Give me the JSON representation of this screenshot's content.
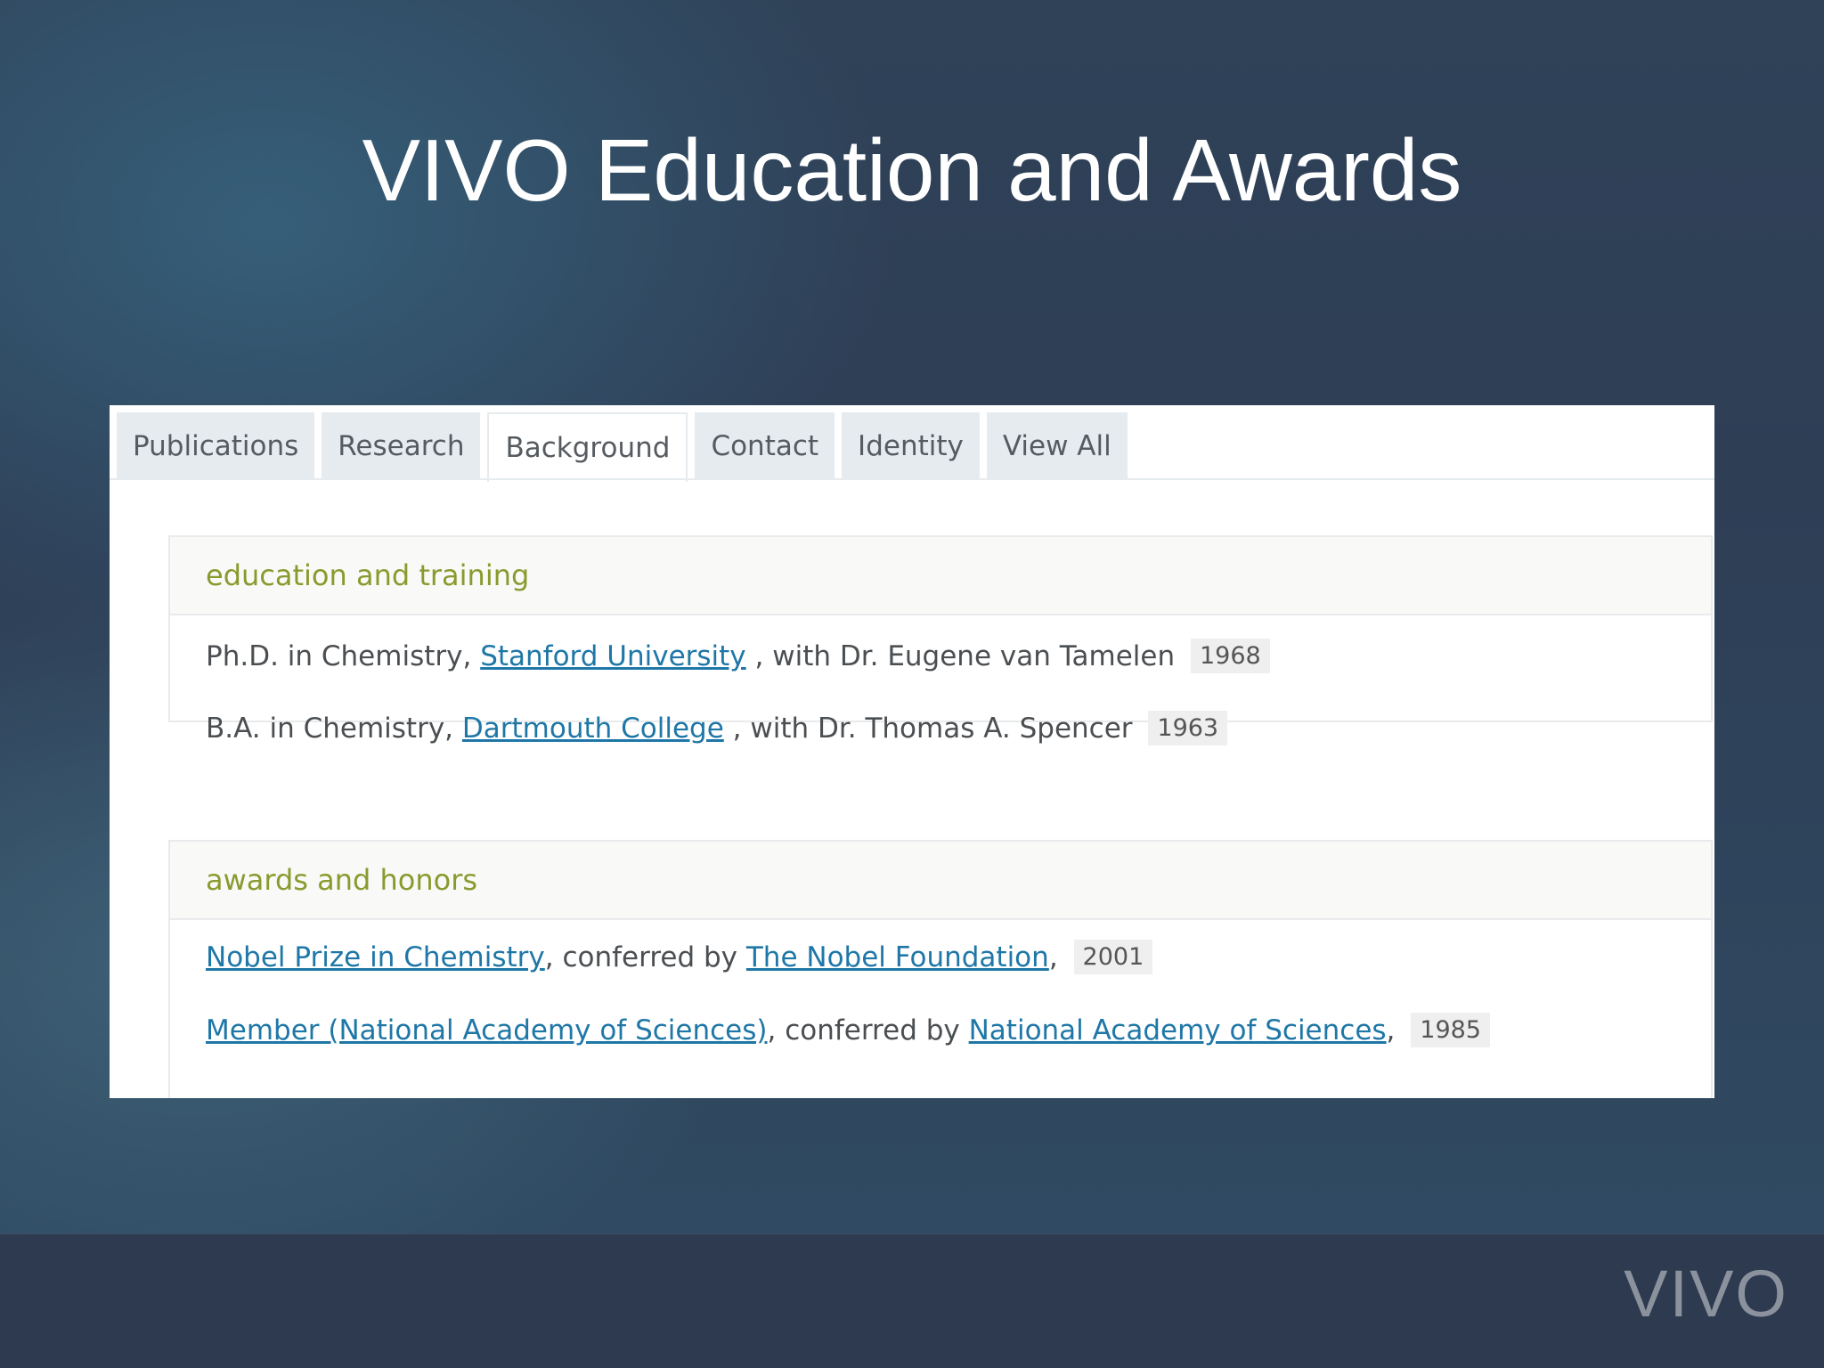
{
  "slide": {
    "title": "VIVO Education and Awards",
    "footer_logo": "VIVO"
  },
  "tabs": [
    {
      "label": "Publications"
    },
    {
      "label": "Research"
    },
    {
      "label": "Background",
      "active": true
    },
    {
      "label": "Contact"
    },
    {
      "label": "Identity"
    },
    {
      "label": "View All"
    }
  ],
  "education": {
    "heading": "education and training",
    "items": [
      {
        "degree": "Ph.D. in Chemistry,",
        "institution": "Stanford University",
        "advisor": " , with Dr. Eugene van Tamelen",
        "year": "1968"
      },
      {
        "degree": "B.A. in Chemistry,",
        "institution": "Dartmouth College",
        "advisor": " , with Dr. Thomas A. Spencer",
        "year": "1963"
      }
    ]
  },
  "awards": {
    "heading": "awards and honors",
    "conferred_text": ", conferred by ",
    "items": [
      {
        "award": "Nobel Prize in Chemistry",
        "organization": "The Nobel Foundation",
        "year": "2001"
      },
      {
        "award": "Member (National Academy of Sciences)",
        "organization": "National Academy of Sciences",
        "year": "1985"
      }
    ]
  },
  "colors": {
    "link": "#1f77a7",
    "section_heading": "#8a9a2e",
    "tab_bg": "#e5ebef"
  }
}
